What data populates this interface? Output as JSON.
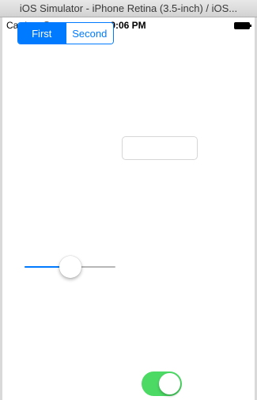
{
  "window": {
    "title": "iOS Simulator - iPhone Retina (3.5-inch) / iOS..."
  },
  "status_bar": {
    "carrier": "Carrier",
    "time": "9:06 PM",
    "wifi_icon": "wifi-icon",
    "battery_icon": "battery-icon"
  },
  "segmented_control": {
    "segments": [
      {
        "label": "First",
        "selected": true
      },
      {
        "label": "Second",
        "selected": false
      }
    ],
    "accent_color": "#007aff"
  },
  "text_field": {
    "value": "",
    "placeholder": ""
  },
  "slider": {
    "value": 0.5,
    "track_color": "#b7b7b7",
    "fill_color": "#007aff"
  },
  "toggle_switch": {
    "on": true,
    "on_color": "#4cd964"
  }
}
